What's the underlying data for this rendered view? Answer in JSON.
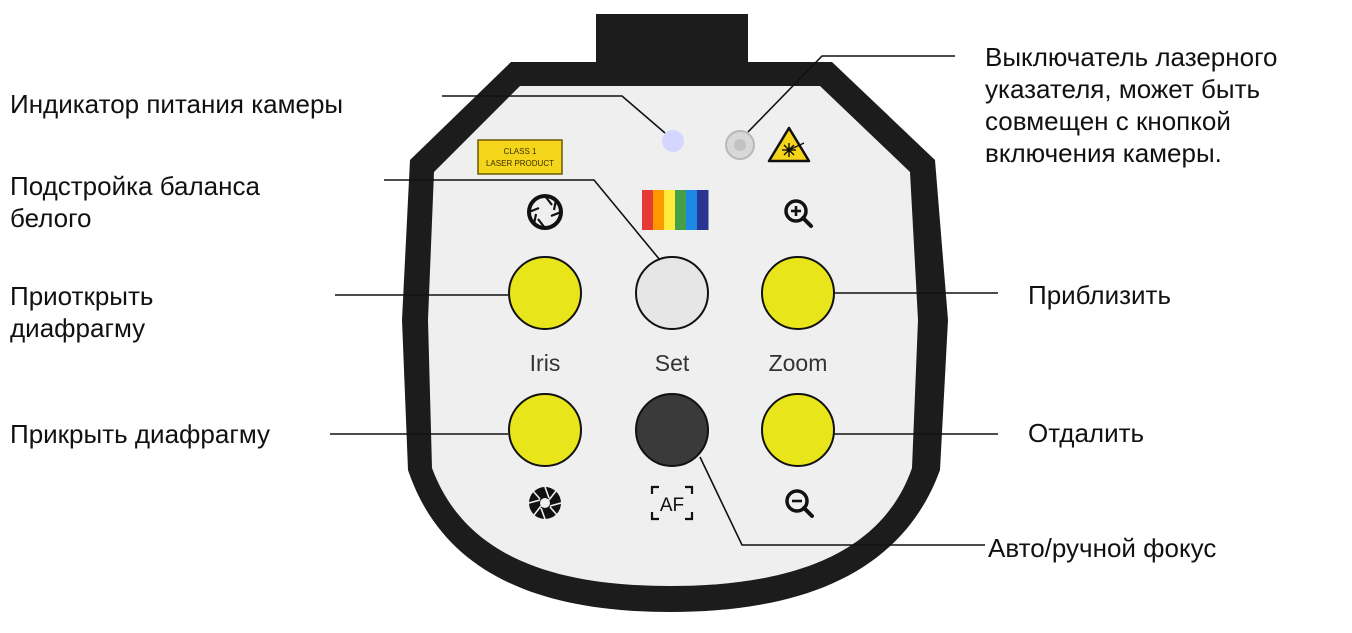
{
  "callouts": {
    "power_indicator": [
      "Индикатор питания камеры"
    ],
    "laser_switch": [
      "Выключатель лазерного",
      "указателя, может быть",
      "совмещен с кнопкой",
      "включения камеры."
    ],
    "white_balance": [
      "Подстройка баланса",
      "белого"
    ],
    "iris_open": [
      "Приоткрыть",
      "диафрагму"
    ],
    "zoom_in": [
      "Приблизить"
    ],
    "iris_close": [
      "Прикрыть диафрагму"
    ],
    "zoom_out": [
      "Отдалить"
    ],
    "focus": [
      "Авто/ручной фокус"
    ]
  },
  "panel": {
    "laser_label": [
      "CLASS 1",
      "LASER PRODUCT"
    ],
    "button_labels": {
      "iris": "Iris",
      "set": "Set",
      "zoom": "Zoom"
    },
    "af_label": "AF"
  },
  "colors": {
    "button_yellow": "#E8E51A",
    "button_set": "#E6E6E6",
    "button_af": "#3A3A3A",
    "body_fill": "#EFEFEF",
    "body_border": "#1C1C1C",
    "power_led": "#D4D6FF",
    "laser_label_bg": "#F5D51A",
    "spectrum": [
      "#E53935",
      "#FF9800",
      "#FFEB3B",
      "#43A047",
      "#1E88E5",
      "#283593"
    ]
  },
  "icons": [
    "iris-open-icon",
    "iris-close-icon",
    "zoom-in-icon",
    "zoom-out-icon",
    "laser-warning-icon",
    "autofocus-frame-icon",
    "laser-switch-icon",
    "power-led-icon",
    "color-spectrum-icon"
  ]
}
